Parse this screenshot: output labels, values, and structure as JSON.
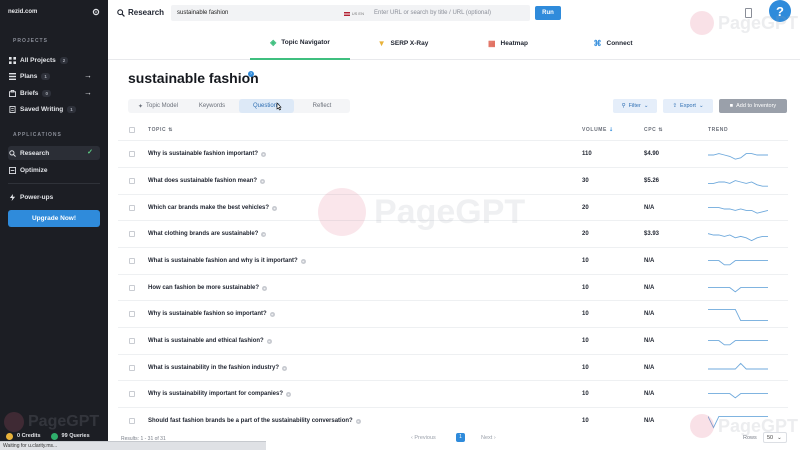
{
  "sidebar": {
    "email": "nezid.com",
    "projects_label": "PROJECTS",
    "items": [
      {
        "label": "All Projects",
        "badge": "2",
        "icon": "grid-icon"
      },
      {
        "label": "Plans",
        "badge": "1",
        "icon": "list-icon"
      },
      {
        "label": "Briefs",
        "badge": "0",
        "icon": "brief-icon"
      },
      {
        "label": "Saved Writing",
        "badge": "1",
        "icon": "doc-icon"
      }
    ],
    "applications_label": "APPLICATIONS",
    "apps": [
      {
        "label": "Research",
        "icon": "search-icon"
      },
      {
        "label": "Optimize",
        "icon": "optimize-icon"
      }
    ],
    "powerups": "Power-ups",
    "upgrade": "Upgrade Now!",
    "credits": "0 Credits",
    "queries": "99 Queries",
    "status": "Waiting for u.clarity.ms..."
  },
  "topbar": {
    "title": "Research",
    "search_value": "sustainable fashion",
    "locale": "US EN",
    "url_placeholder": "Enter URL or search by title / URL (optional)",
    "run": "Run",
    "help": "?"
  },
  "navtabs": [
    {
      "label": "Topic Navigator",
      "icon": "compass-icon"
    },
    {
      "label": "SERP X-Ray",
      "icon": "xray-icon"
    },
    {
      "label": "Heatmap",
      "icon": "heatmap-icon"
    },
    {
      "label": "Connect",
      "icon": "connect-icon"
    }
  ],
  "page": {
    "title": "sustainable fashion",
    "info": "?"
  },
  "subtabs": [
    "Topic Model",
    "Keywords",
    "Questions",
    "Reflect"
  ],
  "actions": {
    "filter": "Filter",
    "export": "Export",
    "inventory": "Add to Inventory"
  },
  "table": {
    "headers": {
      "topic": "TOPIC",
      "volume": "VOLUME",
      "cpc": "CPC",
      "trend": "TREND"
    },
    "rows": [
      {
        "topic": "Why is sustainable fashion important?",
        "volume": "110",
        "cpc": "$4.90",
        "trend": [
          5,
          5,
          6,
          5,
          4,
          2,
          3,
          6,
          6,
          5,
          5,
          5
        ]
      },
      {
        "topic": "What does sustainable fashion mean?",
        "volume": "30",
        "cpc": "$5.26",
        "trend": [
          4,
          4,
          5,
          5,
          4,
          6,
          5,
          4,
          5,
          3,
          2,
          2
        ]
      },
      {
        "topic": "Which car brands make the best vehicles?",
        "volume": "20",
        "cpc": "N/A",
        "trend": [
          6,
          6,
          6,
          5,
          5,
          4,
          5,
          4,
          4,
          2,
          3,
          4
        ]
      },
      {
        "topic": "What clothing brands are sustainable?",
        "volume": "20",
        "cpc": "$3.93",
        "trend": [
          6,
          5,
          5,
          4,
          5,
          3,
          4,
          3,
          1,
          3,
          4,
          4
        ]
      },
      {
        "topic": "What is sustainable fashion and why is it important?",
        "volume": "10",
        "cpc": "N/A",
        "trend": [
          6,
          6,
          6,
          3,
          3,
          6,
          6,
          6,
          6,
          6,
          6,
          6
        ]
      },
      {
        "topic": "How can fashion be more sustainable?",
        "volume": "10",
        "cpc": "N/A",
        "trend": [
          6,
          6,
          6,
          6,
          6,
          3,
          6,
          6,
          6,
          6,
          6,
          6
        ]
      },
      {
        "topic": "Why is sustainable fashion so important?",
        "volume": "10",
        "cpc": "N/A",
        "trend": [
          9,
          9,
          9,
          9,
          9,
          9,
          1,
          1,
          1,
          1,
          1,
          1
        ]
      },
      {
        "topic": "What is sustainable and ethical fashion?",
        "volume": "10",
        "cpc": "N/A",
        "trend": [
          6,
          6,
          6,
          3,
          3,
          6,
          6,
          6,
          6,
          6,
          6,
          6
        ]
      },
      {
        "topic": "What is sustainability in the fashion industry?",
        "volume": "10",
        "cpc": "N/A",
        "trend": [
          5,
          5,
          5,
          5,
          5,
          5,
          9,
          5,
          5,
          5,
          5,
          5
        ]
      },
      {
        "topic": "Why is sustainability important for companies?",
        "volume": "10",
        "cpc": "N/A",
        "trend": [
          6,
          6,
          6,
          6,
          6,
          3,
          6,
          6,
          6,
          6,
          6,
          6
        ]
      },
      {
        "topic": "Should fast fashion brands be a part of the sustainability conversation?",
        "volume": "10",
        "cpc": "N/A",
        "trend": [
          9,
          1,
          9,
          9,
          9,
          9,
          9,
          9,
          9,
          9,
          9,
          9
        ]
      }
    ]
  },
  "footer": {
    "results": "Results: 1 - 31 of 31",
    "prev": "Previous",
    "page": "1",
    "next": "Next",
    "rows_label": "Rows",
    "rows_value": "50"
  },
  "watermark": "PageGPT",
  "colors": {
    "accent": "#2f8bdb",
    "sidebar": "#1c1e24",
    "active_tab": "#3fbf7f",
    "trend": "#6fa9dc"
  }
}
